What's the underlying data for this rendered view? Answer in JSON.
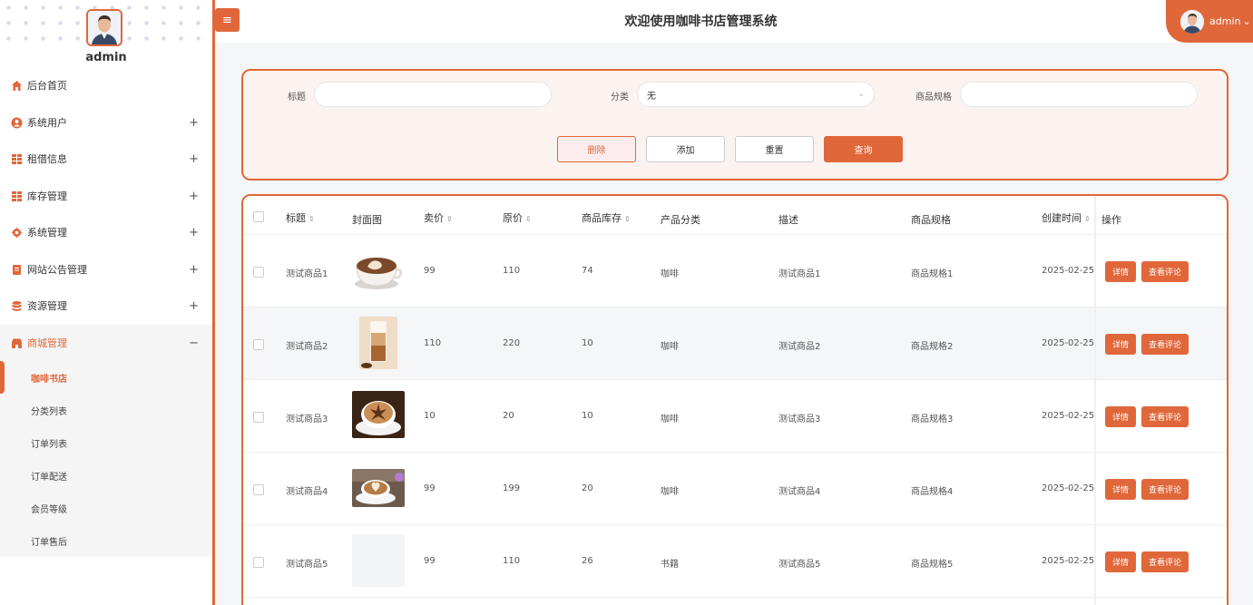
{
  "sidebar": {
    "user_name": "admin",
    "items": [
      {
        "label": "后台首页",
        "icon": "home-icon",
        "expandable": false
      },
      {
        "label": "系统用户",
        "icon": "user-icon",
        "expandable": true
      },
      {
        "label": "租借信息",
        "icon": "grid-icon",
        "expandable": true
      },
      {
        "label": "库存管理",
        "icon": "grid-icon",
        "expandable": true
      },
      {
        "label": "系统管理",
        "icon": "gear-icon",
        "expandable": true
      },
      {
        "label": "网站公告管理",
        "icon": "document-icon",
        "expandable": true
      },
      {
        "label": "资源管理",
        "icon": "database-icon",
        "expandable": true
      },
      {
        "label": "商城管理",
        "icon": "shop-icon",
        "expandable": true
      }
    ],
    "expand_symbol": "+",
    "collapse_symbol": "−",
    "sub_items": [
      "咖啡书店",
      "分类列表",
      "订单列表",
      "订单配送",
      "会员等级",
      "订单售后"
    ],
    "active_sub": "咖啡书店"
  },
  "header": {
    "menu_toggle": "≡",
    "title": "欢迎使用咖啡书店管理系统",
    "user_label": "admin",
    "user_chevron": "⌄"
  },
  "search": {
    "title_label": "标题",
    "title_value": "",
    "category_label": "分类",
    "category_value": "无",
    "spec_label": "商品规格",
    "spec_value": "",
    "delete_label": "删除",
    "add_label": "添加",
    "reset_label": "重置",
    "query_label": "查询"
  },
  "table": {
    "columns": [
      "标题",
      "封面图",
      "卖价",
      "原价",
      "商品库存",
      "产品分类",
      "描述",
      "商品规格",
      "创建时间",
      "操作"
    ],
    "sort_icon": "⇕",
    "detail_label": "详情",
    "review_label": "查看评论",
    "rows": [
      {
        "title": "测试商品1",
        "cover": "latte-cup",
        "price": "99",
        "original": "110",
        "stock": "74",
        "category": "咖啡",
        "desc": "测试商品1",
        "spec": "商品规格1",
        "created": "2025-02-25"
      },
      {
        "title": "测试商品2",
        "cover": "latte-glass",
        "price": "110",
        "original": "220",
        "stock": "10",
        "category": "咖啡",
        "desc": "测试商品2",
        "spec": "商品规格2",
        "created": "2025-02-25"
      },
      {
        "title": "测试商品3",
        "cover": "cappuccino",
        "price": "10",
        "original": "20",
        "stock": "10",
        "category": "咖啡",
        "desc": "测试商品3",
        "spec": "商品规格3",
        "created": "2025-02-25"
      },
      {
        "title": "测试商品4",
        "cover": "heart-latte",
        "price": "99",
        "original": "199",
        "stock": "20",
        "category": "咖啡",
        "desc": "测试商品4",
        "spec": "商品规格4",
        "created": "2025-02-25"
      },
      {
        "title": "测试商品5",
        "cover": "blank",
        "price": "99",
        "original": "110",
        "stock": "26",
        "category": "书籍",
        "desc": "测试商品5",
        "spec": "商品规格5",
        "created": "2025-02-25"
      }
    ]
  },
  "colors": {
    "accent": "#e0673a",
    "panel_bg": "#fbf3f0"
  }
}
